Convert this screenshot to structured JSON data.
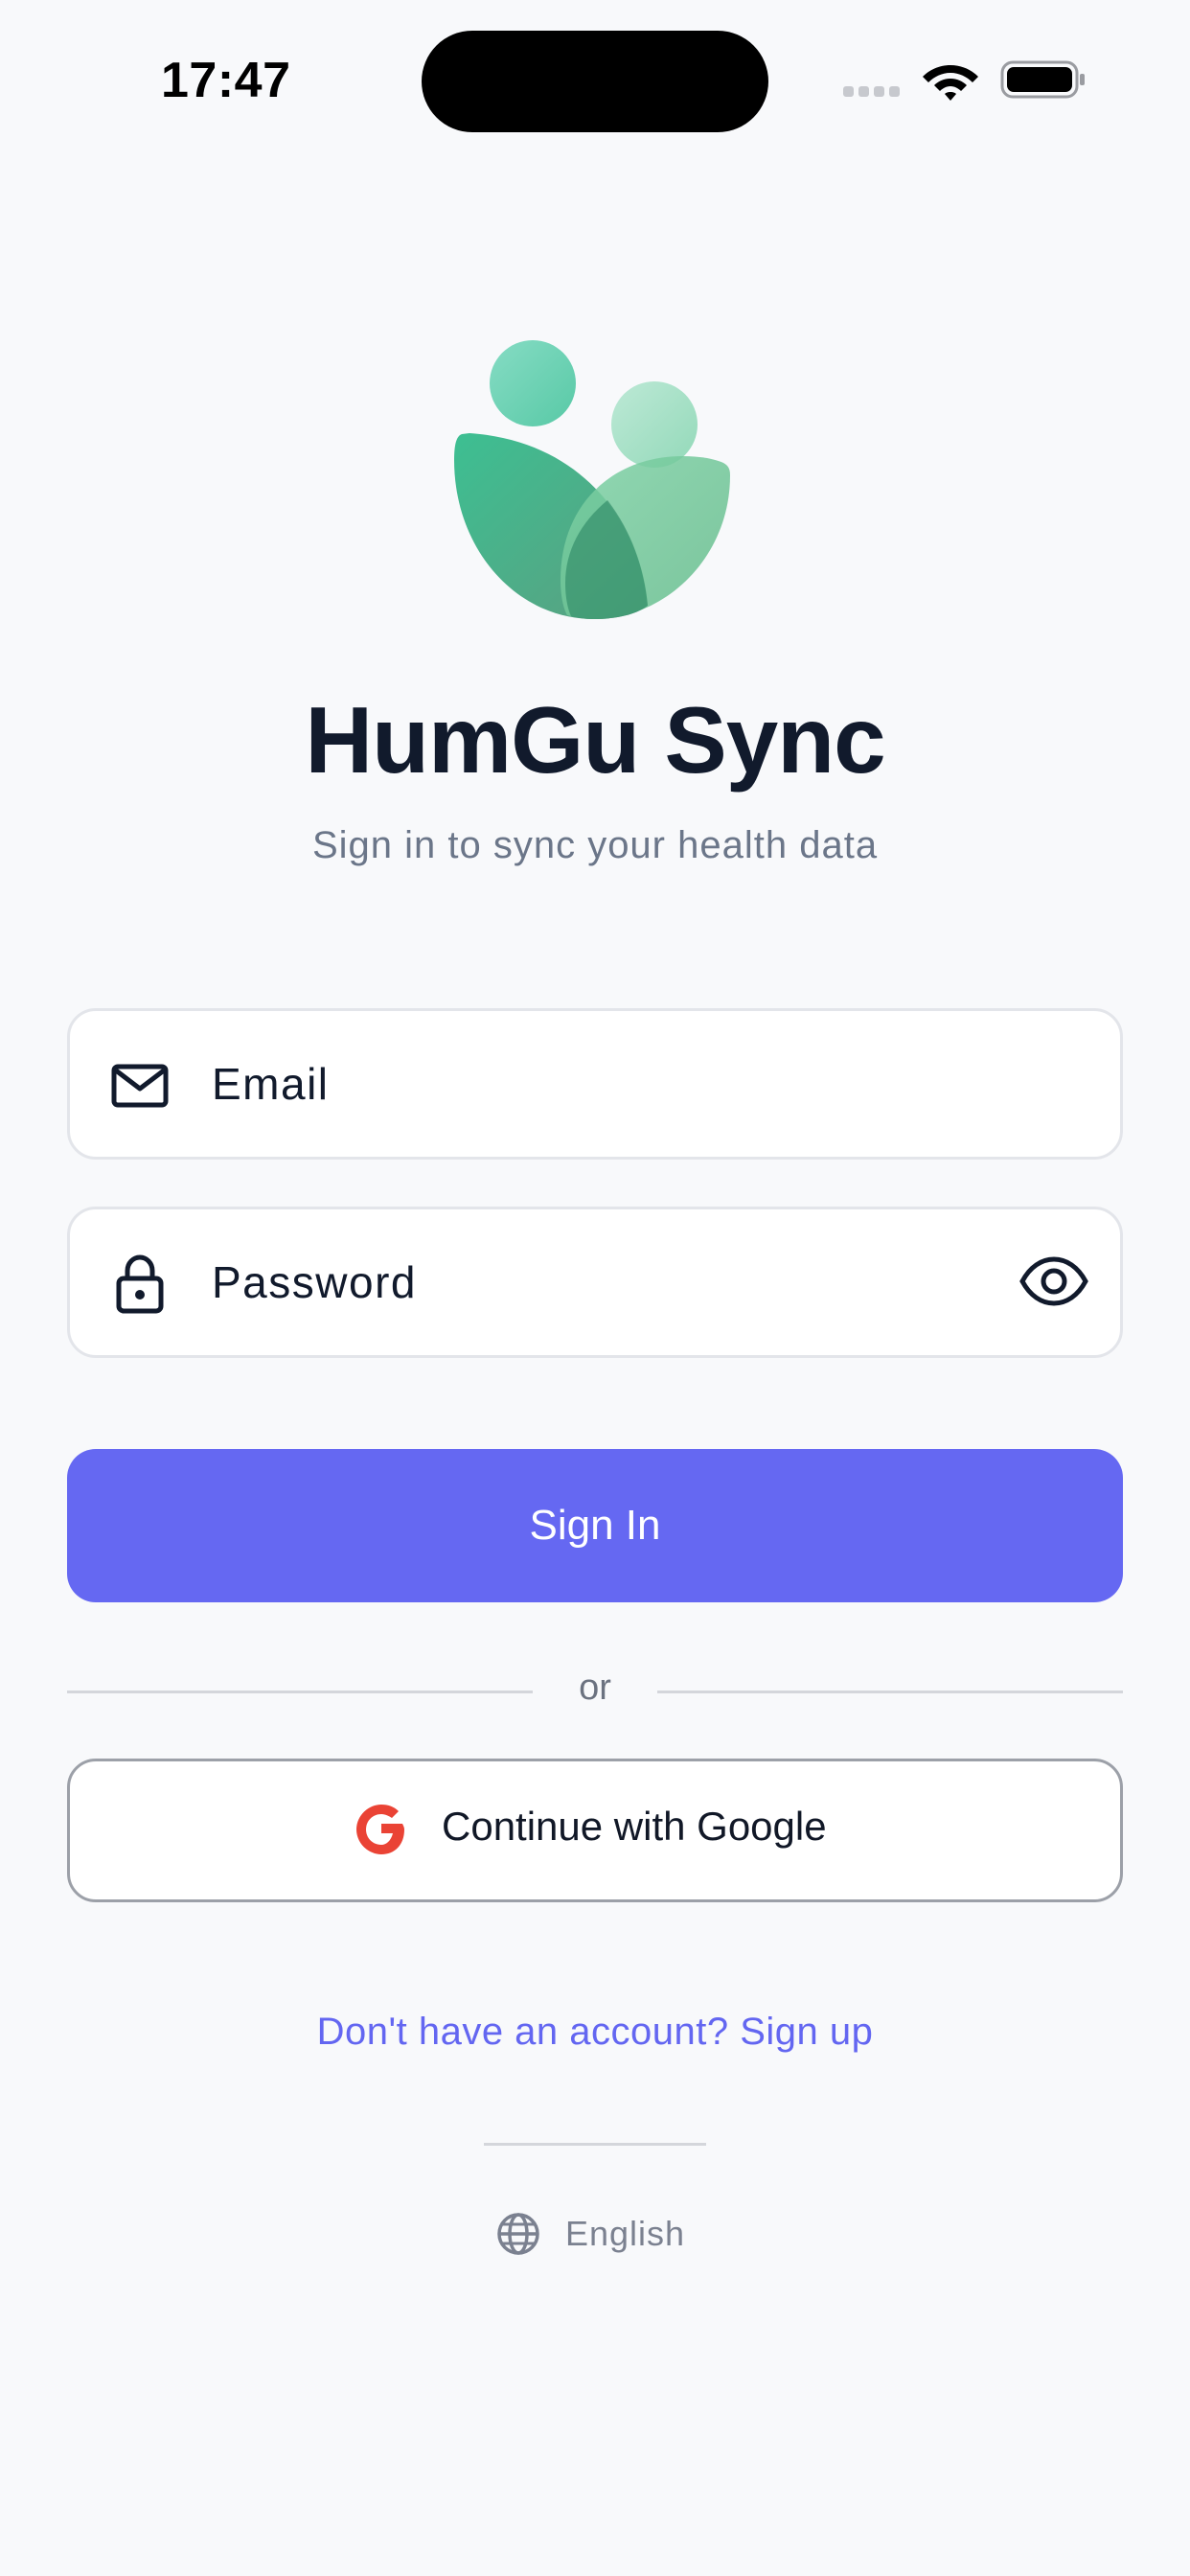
{
  "status_bar": {
    "time": "17:47"
  },
  "app": {
    "title": "HumGu Sync",
    "subtitle": "Sign in to sync your health data"
  },
  "form": {
    "email_placeholder": "Email",
    "email_icon": "mail-icon",
    "password_placeholder": "Password",
    "password_icon": "lock-icon",
    "visibility_icon": "eye-icon",
    "sign_in_label": "Sign In",
    "divider_text": "or",
    "google_label": "Continue with Google",
    "google_icon": "google-icon"
  },
  "footer": {
    "signup_text": "Don't have an account? Sign up",
    "language_label": "English",
    "language_icon": "globe-icon"
  },
  "colors": {
    "primary": "#6568f2",
    "link": "#6366f1",
    "title": "#111a2c",
    "subtitle": "#6b7689",
    "background": "#f8f9fb",
    "logo_green": "#3dbb8e",
    "google_red": "#ea4335"
  }
}
